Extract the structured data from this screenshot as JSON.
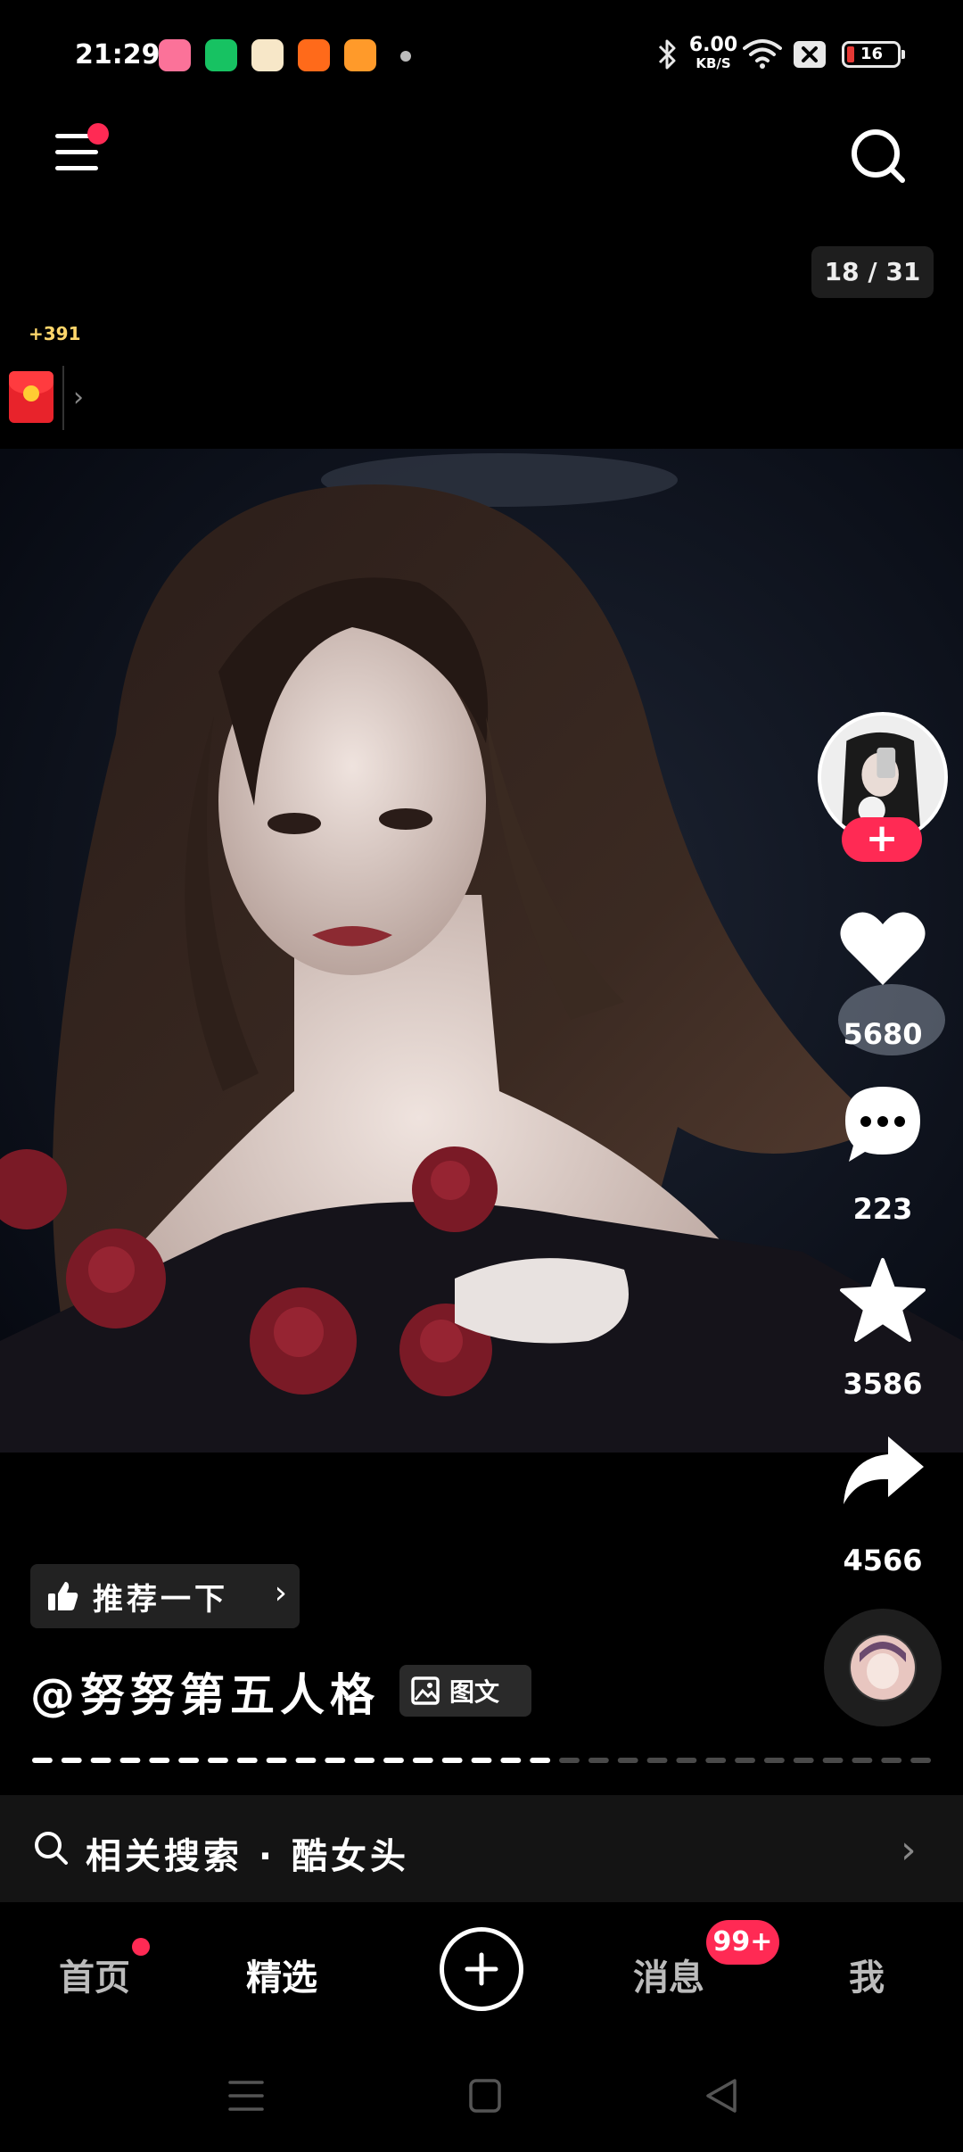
{
  "status_bar": {
    "time": "21:29",
    "net_speed_value": "6.00",
    "net_speed_unit": "KB/S",
    "battery_level": "16",
    "icons": [
      "bilibili-app-icon",
      "battery-app-icon",
      "orange-app-icon",
      "shopping-app-icon",
      "video-app-icon",
      "bluetooth-icon",
      "wifi-icon",
      "sim-icon"
    ]
  },
  "header": {
    "page_counter": "18 / 31"
  },
  "red_packet": {
    "coin_count": "+391"
  },
  "rail": {
    "likes": "5680",
    "comments": "223",
    "favorites": "3586",
    "shares": "4566",
    "follow_label": "+"
  },
  "post": {
    "recommend_label": "推荐一下",
    "author": "@努努第五人格",
    "type_tag": "图文",
    "progress": {
      "total_segments": 31,
      "current": 18
    }
  },
  "related_search": {
    "label": "相关搜索 · 酷女头"
  },
  "bottom_nav": {
    "home": "首页",
    "featured": "精选",
    "messages": "消息",
    "me": "我",
    "messages_badge": "99+"
  },
  "colors": {
    "accent": "#ff2a54",
    "background": "#000000",
    "coin": "#ffd66b"
  }
}
